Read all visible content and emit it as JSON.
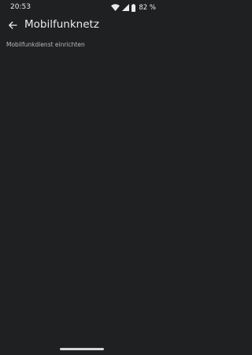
{
  "status_bar": {
    "time": "20:53",
    "battery_percent": "82 %",
    "icons": [
      "wifi-icon",
      "signal-icon",
      "battery-icon"
    ]
  },
  "header": {
    "back_icon": "arrow-left-icon",
    "title": "Mobilfunknetz"
  },
  "content": {
    "items": [
      {
        "label": "Mobilfunkdienst einrichten"
      }
    ]
  },
  "colors": {
    "background": "#1f2022",
    "title_text": "#ececec",
    "secondary_text": "#b8b8b8"
  }
}
